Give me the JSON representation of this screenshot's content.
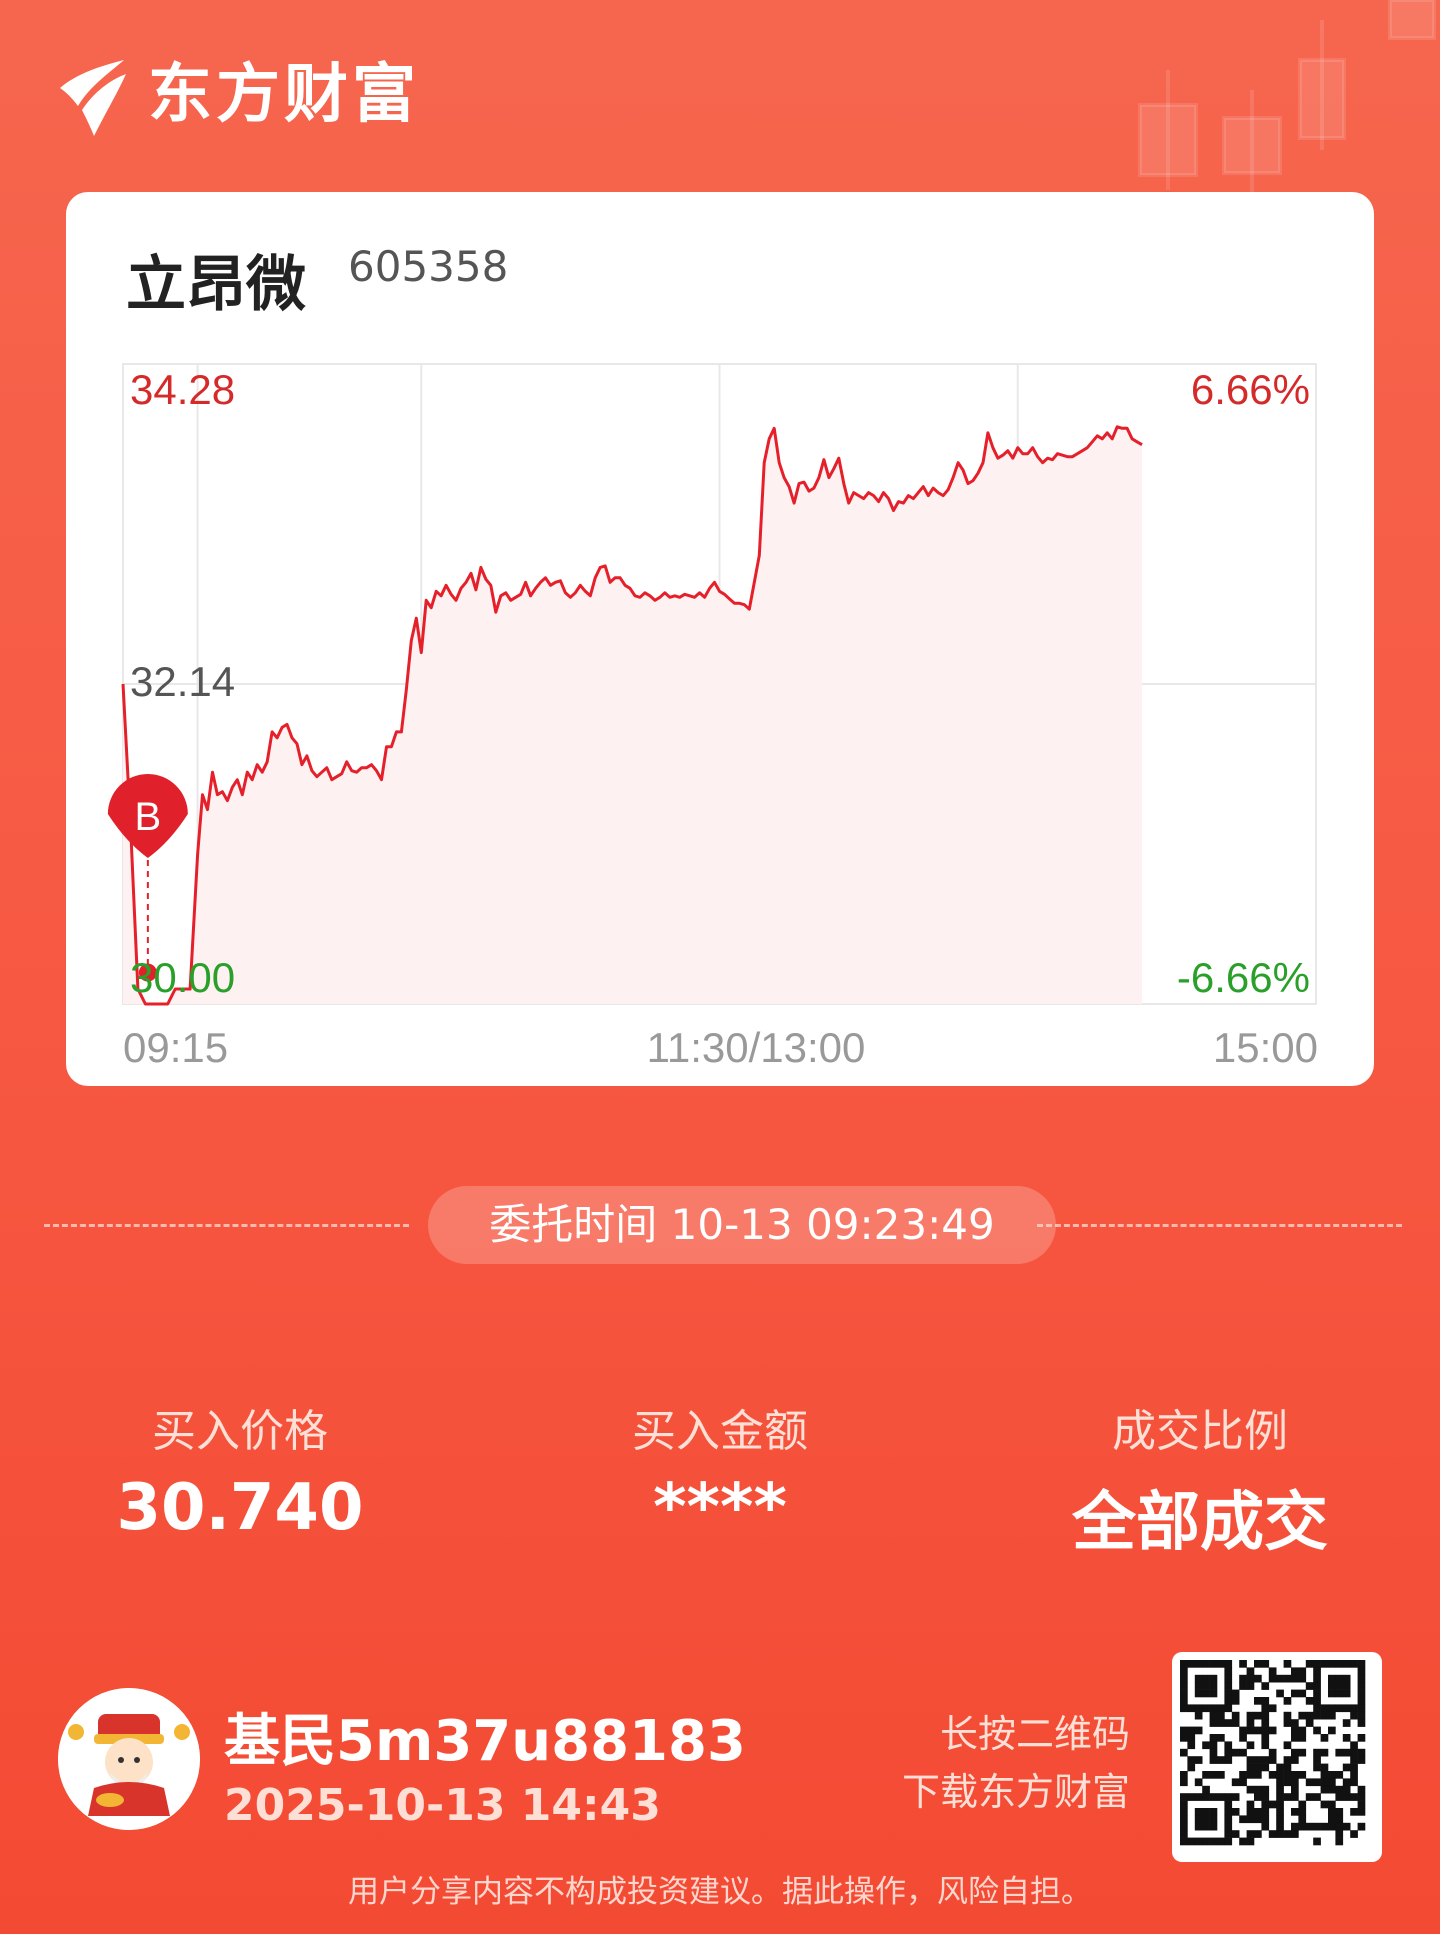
{
  "brand": {
    "name": "东方财富",
    "logo_icon": "eastmoney-logo-icon"
  },
  "stock": {
    "name": "立昂微",
    "code": "605358"
  },
  "chart_data": {
    "type": "line",
    "y_left_ticks": [
      "34.28",
      "32.14",
      "30.00"
    ],
    "y_right_ticks": [
      "6.66%",
      "-6.66%"
    ],
    "x_ticks": [
      "09:15",
      "11:30/13:00",
      "15:00"
    ],
    "ylim": [
      30.0,
      34.28
    ],
    "x_range": [
      0,
      240
    ],
    "grid": true,
    "colors": {
      "line": "#e5202a",
      "fill": "#fdf1f1",
      "up": "#d42a2a",
      "down": "#2aa02a",
      "neutral": "#555555",
      "grid": "#e8e8e8"
    },
    "buy_marker": {
      "label": "B",
      "x": 5,
      "price": 30.21
    },
    "series": [
      {
        "points": [
          [
            0,
            32.14
          ],
          [
            1.5,
            31.2
          ],
          [
            3,
            30.1
          ],
          [
            4.5,
            30.0
          ],
          [
            6,
            30.0
          ],
          [
            7.5,
            30.0
          ],
          [
            9,
            30.0
          ],
          [
            10.5,
            30.1
          ],
          [
            12,
            30.1
          ],
          [
            13.5,
            30.1
          ],
          [
            15,
            31.0
          ],
          [
            16,
            31.4
          ],
          [
            17,
            31.3
          ],
          [
            18,
            31.55
          ],
          [
            19,
            31.4
          ],
          [
            20,
            31.42
          ],
          [
            21,
            31.36
          ],
          [
            22,
            31.45
          ],
          [
            23,
            31.5
          ],
          [
            24,
            31.4
          ],
          [
            25,
            31.55
          ],
          [
            26,
            31.5
          ],
          [
            27,
            31.6
          ],
          [
            28,
            31.55
          ],
          [
            29,
            31.62
          ],
          [
            30,
            31.82
          ],
          [
            31,
            31.78
          ],
          [
            32,
            31.85
          ],
          [
            33,
            31.87
          ],
          [
            34,
            31.78
          ],
          [
            35,
            31.74
          ],
          [
            36,
            31.6
          ],
          [
            37,
            31.66
          ],
          [
            38,
            31.56
          ],
          [
            39,
            31.52
          ],
          [
            40,
            31.55
          ],
          [
            41,
            31.58
          ],
          [
            42,
            31.5
          ],
          [
            43,
            31.52
          ],
          [
            44,
            31.54
          ],
          [
            45,
            31.62
          ],
          [
            46,
            31.56
          ],
          [
            47,
            31.55
          ],
          [
            48,
            31.58
          ],
          [
            49,
            31.58
          ],
          [
            50,
            31.6
          ],
          [
            51,
            31.56
          ],
          [
            52,
            31.5
          ],
          [
            53,
            31.72
          ],
          [
            54,
            31.72
          ],
          [
            55,
            31.82
          ],
          [
            56,
            31.82
          ],
          [
            57,
            32.1
          ],
          [
            58,
            32.43
          ],
          [
            59,
            32.58
          ],
          [
            60,
            32.35
          ],
          [
            61,
            32.7
          ],
          [
            62,
            32.65
          ],
          [
            63,
            32.76
          ],
          [
            64,
            32.73
          ],
          [
            65,
            32.8
          ],
          [
            66,
            32.74
          ],
          [
            67,
            32.7
          ],
          [
            68,
            32.78
          ],
          [
            69,
            32.82
          ],
          [
            70,
            32.88
          ],
          [
            71,
            32.77
          ],
          [
            72,
            32.92
          ],
          [
            73,
            32.84
          ],
          [
            74,
            32.8
          ],
          [
            75,
            32.62
          ],
          [
            76,
            32.73
          ],
          [
            77,
            32.75
          ],
          [
            78,
            32.7
          ],
          [
            79,
            32.72
          ],
          [
            80,
            32.74
          ],
          [
            81,
            32.82
          ],
          [
            82,
            32.73
          ],
          [
            83,
            32.78
          ],
          [
            84,
            32.82
          ],
          [
            85,
            32.85
          ],
          [
            86,
            32.8
          ],
          [
            87,
            32.82
          ],
          [
            88,
            32.83
          ],
          [
            89,
            32.75
          ],
          [
            90,
            32.72
          ],
          [
            91,
            32.75
          ],
          [
            92,
            32.8
          ],
          [
            93,
            32.76
          ],
          [
            94,
            32.73
          ],
          [
            95,
            32.85
          ],
          [
            96,
            32.92
          ],
          [
            97,
            32.93
          ],
          [
            98,
            32.82
          ],
          [
            99,
            32.85
          ],
          [
            100,
            32.85
          ],
          [
            101,
            32.8
          ],
          [
            102,
            32.78
          ],
          [
            103,
            32.73
          ],
          [
            104,
            32.72
          ],
          [
            105,
            32.75
          ],
          [
            106,
            32.73
          ],
          [
            107,
            32.7
          ],
          [
            108,
            32.72
          ],
          [
            109,
            32.75
          ],
          [
            110,
            32.72
          ],
          [
            111,
            32.73
          ],
          [
            112,
            32.72
          ],
          [
            113,
            32.74
          ],
          [
            114,
            32.73
          ],
          [
            115,
            32.72
          ],
          [
            116,
            32.75
          ],
          [
            117,
            32.72
          ],
          [
            118,
            32.78
          ],
          [
            119,
            32.82
          ],
          [
            120,
            32.76
          ],
          [
            121,
            32.74
          ],
          [
            122,
            32.71
          ],
          [
            123,
            32.68
          ],
          [
            124,
            32.68
          ],
          [
            125,
            32.67
          ],
          [
            126,
            32.64
          ],
          [
            127,
            32.82
          ],
          [
            128,
            33.0
          ],
          [
            129,
            33.62
          ],
          [
            130,
            33.78
          ],
          [
            131,
            33.85
          ],
          [
            132,
            33.62
          ],
          [
            133,
            33.52
          ],
          [
            134,
            33.46
          ],
          [
            135,
            33.35
          ],
          [
            136,
            33.48
          ],
          [
            137,
            33.49
          ],
          [
            138,
            33.43
          ],
          [
            139,
            33.45
          ],
          [
            140,
            33.52
          ],
          [
            141,
            33.64
          ],
          [
            142,
            33.52
          ],
          [
            143,
            33.58
          ],
          [
            144,
            33.65
          ],
          [
            145,
            33.48
          ],
          [
            146,
            33.35
          ],
          [
            147,
            33.42
          ],
          [
            148,
            33.4
          ],
          [
            149,
            33.38
          ],
          [
            150,
            33.42
          ],
          [
            151,
            33.4
          ],
          [
            152,
            33.36
          ],
          [
            153,
            33.42
          ],
          [
            154,
            33.38
          ],
          [
            155,
            33.3
          ],
          [
            156,
            33.36
          ],
          [
            157,
            33.35
          ],
          [
            158,
            33.4
          ],
          [
            159,
            33.38
          ],
          [
            160,
            33.42
          ],
          [
            161,
            33.46
          ],
          [
            162,
            33.4
          ],
          [
            163,
            33.45
          ],
          [
            164,
            33.42
          ],
          [
            165,
            33.4
          ],
          [
            166,
            33.44
          ],
          [
            167,
            33.52
          ],
          [
            168,
            33.62
          ],
          [
            169,
            33.57
          ],
          [
            170,
            33.48
          ],
          [
            171,
            33.5
          ],
          [
            172,
            33.55
          ],
          [
            173,
            33.62
          ],
          [
            174,
            33.82
          ],
          [
            175,
            33.72
          ],
          [
            176,
            33.65
          ],
          [
            177,
            33.67
          ],
          [
            178,
            33.7
          ],
          [
            179,
            33.65
          ],
          [
            180,
            33.72
          ],
          [
            181,
            33.68
          ],
          [
            182,
            33.68
          ],
          [
            183,
            33.72
          ],
          [
            184,
            33.66
          ],
          [
            185,
            33.62
          ],
          [
            186,
            33.65
          ],
          [
            187,
            33.64
          ],
          [
            188,
            33.68
          ],
          [
            189,
            33.67
          ],
          [
            190,
            33.66
          ],
          [
            191,
            33.66
          ],
          [
            192,
            33.68
          ],
          [
            193,
            33.7
          ],
          [
            194,
            33.72
          ],
          [
            195,
            33.76
          ],
          [
            196,
            33.8
          ],
          [
            197,
            33.78
          ],
          [
            198,
            33.82
          ],
          [
            199,
            33.78
          ],
          [
            200,
            33.86
          ],
          [
            201,
            33.85
          ],
          [
            202,
            33.85
          ],
          [
            203,
            33.78
          ],
          [
            204,
            33.76
          ],
          [
            205,
            33.74
          ]
        ]
      }
    ]
  },
  "order": {
    "time_label": "委托时间",
    "time_value": "10-13 09:23:49"
  },
  "stats": [
    {
      "label": "买入价格",
      "value": "30.740"
    },
    {
      "label": "买入金额",
      "value": "****"
    },
    {
      "label": "成交比例",
      "value": "全部成交"
    }
  ],
  "user": {
    "name": "基民5m37u88183",
    "datetime": "2025-10-13 14:43",
    "avatar_icon": "god-of-wealth-avatar-icon"
  },
  "qr": {
    "line1": "长按二维码",
    "line2": "下载东方财富",
    "icon": "qr-code-icon"
  },
  "disclaimer": "用户分享内容不构成投资建议。据此操作，风险自担。"
}
